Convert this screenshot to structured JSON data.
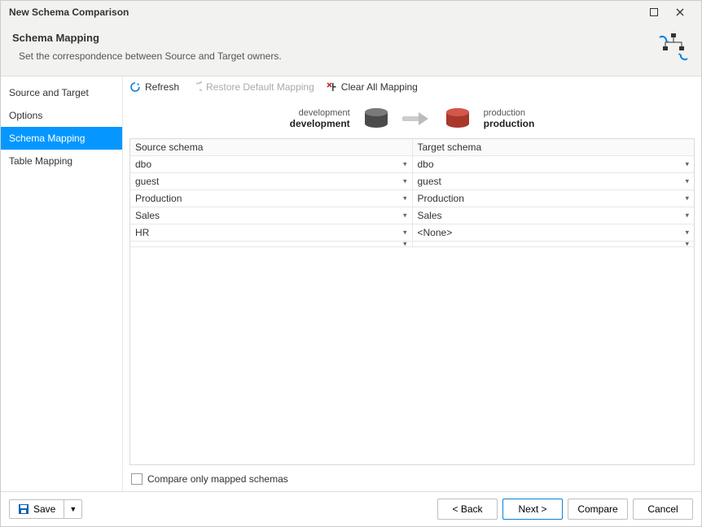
{
  "window": {
    "title": "New Schema Comparison"
  },
  "header": {
    "title": "Schema Mapping",
    "subtitle": "Set the correspondence between Source and Target owners."
  },
  "sidebar": {
    "items": [
      {
        "label": "Source and Target"
      },
      {
        "label": "Options"
      },
      {
        "label": "Schema Mapping"
      },
      {
        "label": "Table Mapping"
      }
    ],
    "active_index": 2
  },
  "toolbar": {
    "refresh": "Refresh",
    "restore": "Restore Default Mapping",
    "clear": "Clear All Mapping"
  },
  "db": {
    "source_top": "development",
    "source_bottom": "development",
    "target_top": "production",
    "target_bottom": "production"
  },
  "mapping": {
    "source_header": "Source schema",
    "target_header": "Target schema",
    "rows": [
      {
        "source": "dbo",
        "target": "dbo"
      },
      {
        "source": "guest",
        "target": "guest"
      },
      {
        "source": "Production",
        "target": "Production"
      },
      {
        "source": "Sales",
        "target": "Sales"
      },
      {
        "source": "HR",
        "target": "<None>"
      },
      {
        "source": "",
        "target": ""
      }
    ]
  },
  "compare_only": {
    "label": "Compare only mapped schemas",
    "checked": false
  },
  "footer": {
    "save": "Save",
    "back": "< Back",
    "next": "Next >",
    "compare": "Compare",
    "cancel": "Cancel"
  }
}
